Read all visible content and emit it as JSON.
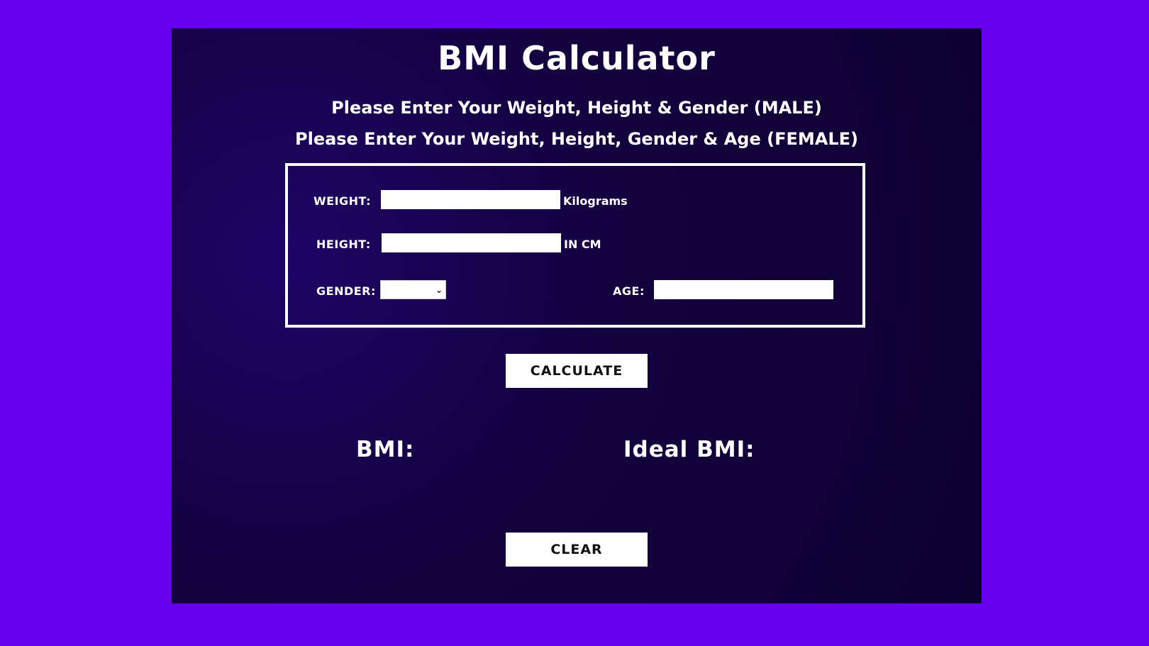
{
  "app": {
    "title": "BMI Calculator",
    "instructions": [
      "Please Enter Your Weight, Height & Gender (MALE)",
      "Please Enter Your Weight, Height, Gender & Age (FEMALE)"
    ]
  },
  "form": {
    "weight": {
      "label": "WEIGHT:",
      "value": "",
      "unit": "Kilograms"
    },
    "height": {
      "label": "HEIGHT:",
      "value": "",
      "unit": "IN CM"
    },
    "gender": {
      "label": "GENDER:",
      "selected": ""
    },
    "age": {
      "label": "AGE:",
      "value": ""
    }
  },
  "actions": {
    "calculate_label": "CALCULATE",
    "clear_label": "CLEAR"
  },
  "results": {
    "bmi_label": "BMI:",
    "ideal_bmi_label": "Ideal BMI:"
  },
  "colors": {
    "background": "#6600ee",
    "panel": "#13023f",
    "text": "#ffffff",
    "button_text": "#111111"
  },
  "icons": {
    "gender_dropdown": "chevron-down-icon"
  }
}
